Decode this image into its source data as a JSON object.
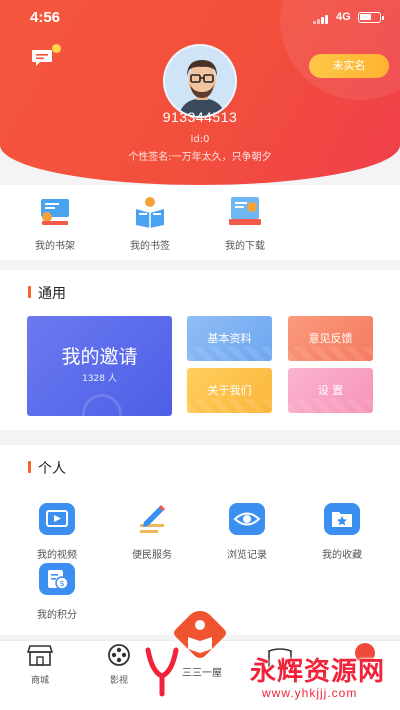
{
  "status_bar": {
    "time": "4:56",
    "network": "4G"
  },
  "header": {
    "realname_button": "未实名",
    "user_id": "913344513",
    "id_line": "Id:0",
    "signature": "个性签名:一万年太久，只争朝夕"
  },
  "quick_actions": [
    {
      "label": "我的书架",
      "icon": "bookshelf-icon"
    },
    {
      "label": "我的书签",
      "icon": "bookmark-reader-icon"
    },
    {
      "label": "我的下载",
      "icon": "download-icon"
    }
  ],
  "general": {
    "title": "通用",
    "invite": {
      "title": "我的邀请",
      "count": "1328 人"
    },
    "tiles": {
      "basic_info": "基本资料",
      "feedback": "意见反馈",
      "about": "关于我们",
      "settings": "设 置"
    }
  },
  "personal": {
    "title": "个人",
    "items": [
      {
        "label": "我的视频",
        "icon": "video-icon"
      },
      {
        "label": "便民服务",
        "icon": "pencil-icon"
      },
      {
        "label": "浏览记录",
        "icon": "eye-icon"
      },
      {
        "label": "我的收藏",
        "icon": "star-folder-icon"
      },
      {
        "label": "我的积分",
        "icon": "points-icon"
      }
    ]
  },
  "tabbar": [
    {
      "label": "商城",
      "icon": "shop-icon"
    },
    {
      "label": "影视",
      "icon": "film-reel-icon"
    }
  ],
  "watermark": {
    "brand": "永辉资源网",
    "url": "www.yhkjjj.com",
    "center_text": "三三一屋"
  },
  "colors": {
    "header_red": "#f2503c",
    "accent_orange": "#f5602e",
    "invite_blue": "#5b68eb"
  }
}
